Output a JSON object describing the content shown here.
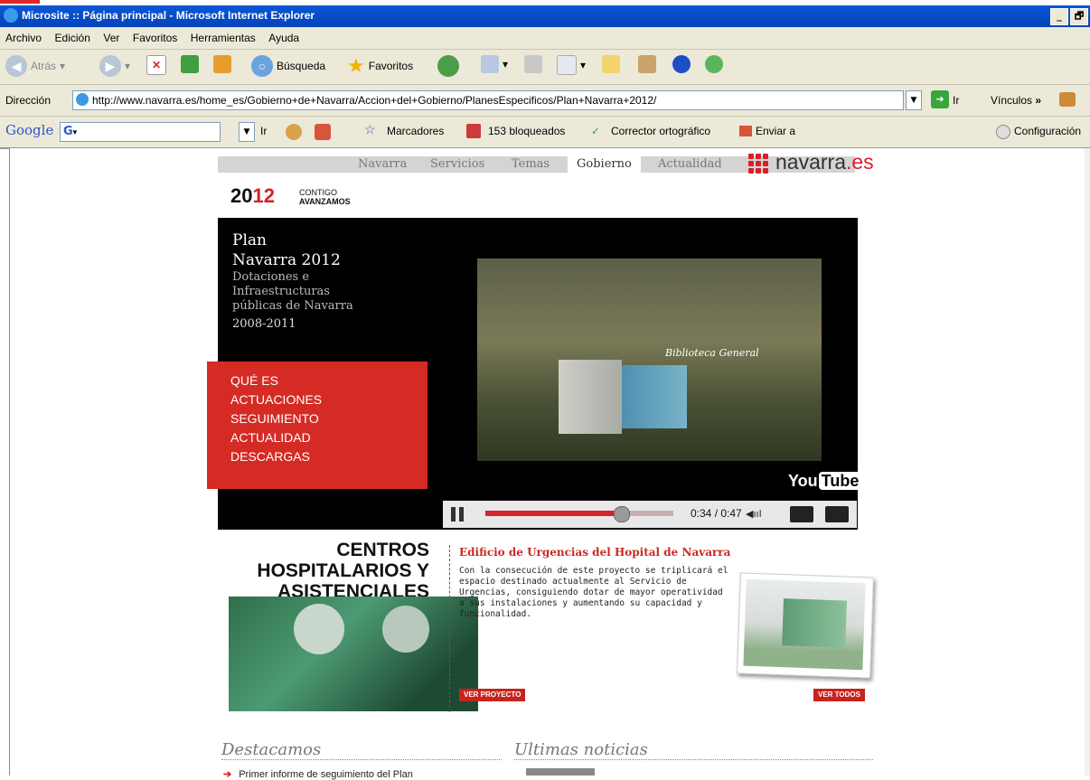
{
  "window": {
    "title": "Microsite :: Página principal - Microsoft Internet Explorer",
    "controls": [
      "_",
      "🗗"
    ]
  },
  "menu": [
    "Archivo",
    "Edición",
    "Ver",
    "Favoritos",
    "Herramientas",
    "Ayuda"
  ],
  "toolbar": {
    "back_label": "Atrás",
    "search_label": "Búsqueda",
    "favorites_label": "Favoritos"
  },
  "address": {
    "label": "Dirección",
    "url": "http://www.navarra.es/home_es/Gobierno+de+Navarra/Accion+del+Gobierno/PlanesEspecificos/Plan+Navarra+2012/",
    "go_label": "Ir",
    "links_label": "Vínculos"
  },
  "google_toolbar": {
    "brand": "Google",
    "g_button": "G",
    "go_label": "Ir",
    "bookmarks": "Marcadores",
    "blocked": "153 bloqueados",
    "spell": "Corrector ortográfico",
    "send": "Enviar a",
    "settings": "Configuración"
  },
  "site": {
    "nav": [
      "Navarra",
      "Servicios",
      "Temas",
      "Gobierno",
      "Actualidad"
    ],
    "active_nav": "Gobierno",
    "logo_prefix": "navarra",
    "logo_suffix": ".es",
    "brand_year_a": "20",
    "brand_year_b": "12",
    "brand_line1": "CONTIGO",
    "brand_line2": "AVANZAMOS"
  },
  "plan": {
    "line1": "Plan",
    "line2": "Navarra 2012",
    "line3": "Dotaciones e",
    "line4": "Infraestructuras",
    "line5": "públicas de Navarra",
    "years": "2008-2011"
  },
  "side_menu": [
    "QUÉ ES",
    "ACTUACIONES",
    "SEGUIMIENTO",
    "ACTUALIDAD",
    "DESCARGAS"
  ],
  "video": {
    "caption": "Biblioteca General",
    "yt_you": "You",
    "yt_tube": "Tube",
    "time": "0:34 / 0:47",
    "progress": 0.72
  },
  "feature": {
    "section_title_1": "CENTROS",
    "section_title_2": "HOSPITALARIOS Y",
    "section_title_3": "ASISTENCIALES",
    "headline": "Edificio de Urgencias del Hopital de Navarra",
    "body": "Con la consecución de este proyecto se triplicará el espacio destinado actualmente al Servicio de Urgencias, consiguiendo dotar de mayor operatividad a sus instalaciones y aumentando su capacidad y funcionalidad.",
    "btn_project": "VER PROYECTO",
    "btn_all": "VER TODOS"
  },
  "bottom": {
    "destacamos": "Destacamos",
    "noticias": "Ultimas noticias",
    "first_item": "Primer informe de seguimiento del Plan"
  }
}
